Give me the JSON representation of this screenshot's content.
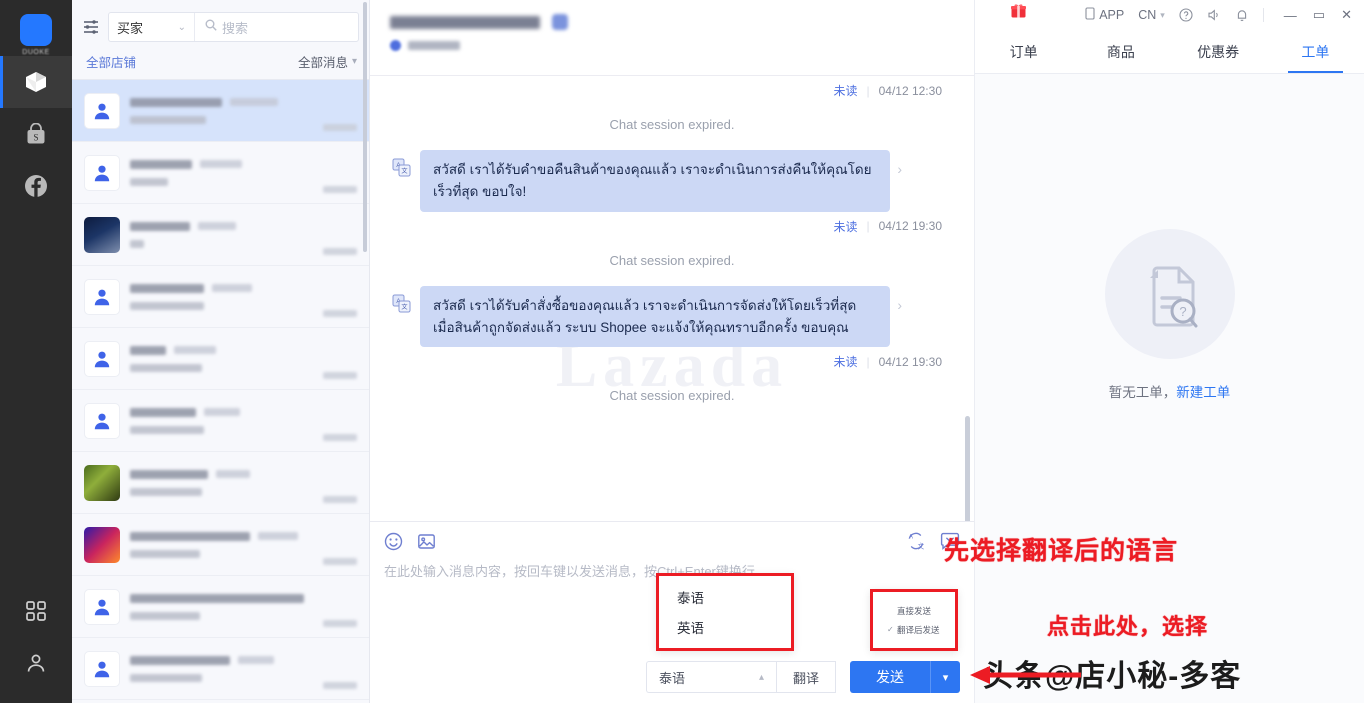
{
  "rail": {
    "logo_text": "DUOKE",
    "items": [
      {
        "name": "lazada-channel",
        "icon": "lazada-icon",
        "active": true
      },
      {
        "name": "shopee-channel",
        "icon": "shopee-bag-icon",
        "active": false
      },
      {
        "name": "facebook-channel",
        "icon": "facebook-icon",
        "active": false
      }
    ],
    "bottom_items": [
      {
        "name": "apps-grid",
        "icon": "grid-apps-icon"
      },
      {
        "name": "account",
        "icon": "user-icon"
      }
    ]
  },
  "sidebar": {
    "menu_icon": "list-filter-icon",
    "role_select": {
      "label": "买家",
      "caret": "⌄"
    },
    "search": {
      "placeholder": "搜索",
      "icon": "search-icon"
    },
    "shop_filter": "全部店铺",
    "message_filter": "全部消息",
    "conversations": [
      {
        "avatar": "generic",
        "selected": true,
        "name_w": 92,
        "tag_w": 48,
        "sub_w": 76
      },
      {
        "avatar": "generic",
        "selected": false,
        "name_w": 62,
        "tag_w": 42,
        "sub_w": 38
      },
      {
        "avatar": "img1",
        "selected": false,
        "name_w": 60,
        "tag_w": 38,
        "sub_w": 14
      },
      {
        "avatar": "generic",
        "selected": false,
        "name_w": 74,
        "tag_w": 40,
        "sub_w": 74
      },
      {
        "avatar": "generic",
        "selected": false,
        "name_w": 36,
        "tag_w": 42,
        "sub_w": 72
      },
      {
        "avatar": "generic",
        "selected": false,
        "name_w": 66,
        "tag_w": 36,
        "sub_w": 74
      },
      {
        "avatar": "img2",
        "selected": false,
        "name_w": 78,
        "tag_w": 34,
        "sub_w": 72
      },
      {
        "avatar": "img3",
        "selected": false,
        "name_w": 120,
        "tag_w": 40,
        "sub_w": 70
      },
      {
        "avatar": "generic",
        "selected": false,
        "name_w": 174,
        "tag_w": 0,
        "sub_w": 70
      },
      {
        "avatar": "generic",
        "selected": false,
        "name_w": 100,
        "tag_w": 36,
        "sub_w": 72
      }
    ]
  },
  "chat": {
    "messages": [
      {
        "type": "meta",
        "unread": "未读",
        "time": "04/12 12:30"
      },
      {
        "type": "system",
        "text": "Chat session expired."
      },
      {
        "type": "incoming",
        "icon": "translate-badge-icon",
        "text": "สวัสดี เราได้รับคำขอคืนสินค้าของคุณแล้ว เราจะดำเนินการส่งคืนให้คุณโดยเร็วที่สุด ขอบใจ!"
      },
      {
        "type": "meta",
        "unread": "未读",
        "time": "04/12 19:30"
      },
      {
        "type": "system",
        "text": "Chat session expired."
      },
      {
        "type": "incoming",
        "icon": "translate-badge-icon",
        "text": "สวัสดี เราได้รับคำสั่งซื้อของคุณแล้ว เราจะดำเนินการจัดส่งให้โดยเร็วที่สุด เมื่อสินค้าถูกจัดส่งแล้ว ระบบ Shopee จะแจ้งให้คุณทราบอีกครั้ง ขอบคุณ"
      },
      {
        "type": "meta",
        "unread": "未读",
        "time": "04/12 19:30"
      },
      {
        "type": "system",
        "text": "Chat session expired."
      }
    ],
    "watermark": "Lazada"
  },
  "composer": {
    "toolbar_left": [
      {
        "name": "emoji-icon",
        "label": "emoji"
      },
      {
        "name": "image-icon",
        "label": "image"
      }
    ],
    "toolbar_right": [
      {
        "name": "translate-icon",
        "label": "translate"
      },
      {
        "name": "quick-reply-icon",
        "label": "quick-reply"
      }
    ],
    "placeholder": "在此处输入消息内容，按回车键以发送消息，按Ctrl+Enter键换行",
    "language_select": {
      "value": "泰语",
      "caret": "⌃"
    },
    "language_options": [
      "泰语",
      "英语"
    ],
    "translate_button": "翻译",
    "send_button": "发送",
    "send_caret": "⌄",
    "send_mode_options": [
      {
        "label": "直接发送",
        "checked": false
      },
      {
        "label": "翻译后发送",
        "checked": true
      }
    ]
  },
  "annotations": [
    {
      "name": "annotation-select-language",
      "text": "先选择翻译后的语言"
    },
    {
      "name": "annotation-click-here",
      "text": "点击此处，选择"
    }
  ],
  "right_panel": {
    "topbar": {
      "gift_icon": "gift-icon",
      "app_label": "APP",
      "app_icon": "mobile-icon",
      "lang": "CN",
      "lang_caret": "⌄",
      "help_icon": "help-circle-icon",
      "sound_icon": "speaker-icon",
      "bell_icon": "bell-icon",
      "minimize": "—",
      "maximize": "▭",
      "close": "✕"
    },
    "tabs": [
      {
        "label": "订单",
        "active": false
      },
      {
        "label": "商品",
        "active": false
      },
      {
        "label": "优惠券",
        "active": false
      },
      {
        "label": "工单",
        "active": true
      }
    ],
    "empty": {
      "icon": "document-question-icon",
      "text": "暂无工单，",
      "link": "新建工单"
    }
  },
  "watermark_brand": "头条@店小秘-多客",
  "colors": {
    "accent": "#2d76f2",
    "annotation_red": "#ec1c24",
    "bubble_in": "#ccd8f5",
    "selected_conv": "#d6e3fb",
    "rail_bg": "#2b2b2b"
  }
}
